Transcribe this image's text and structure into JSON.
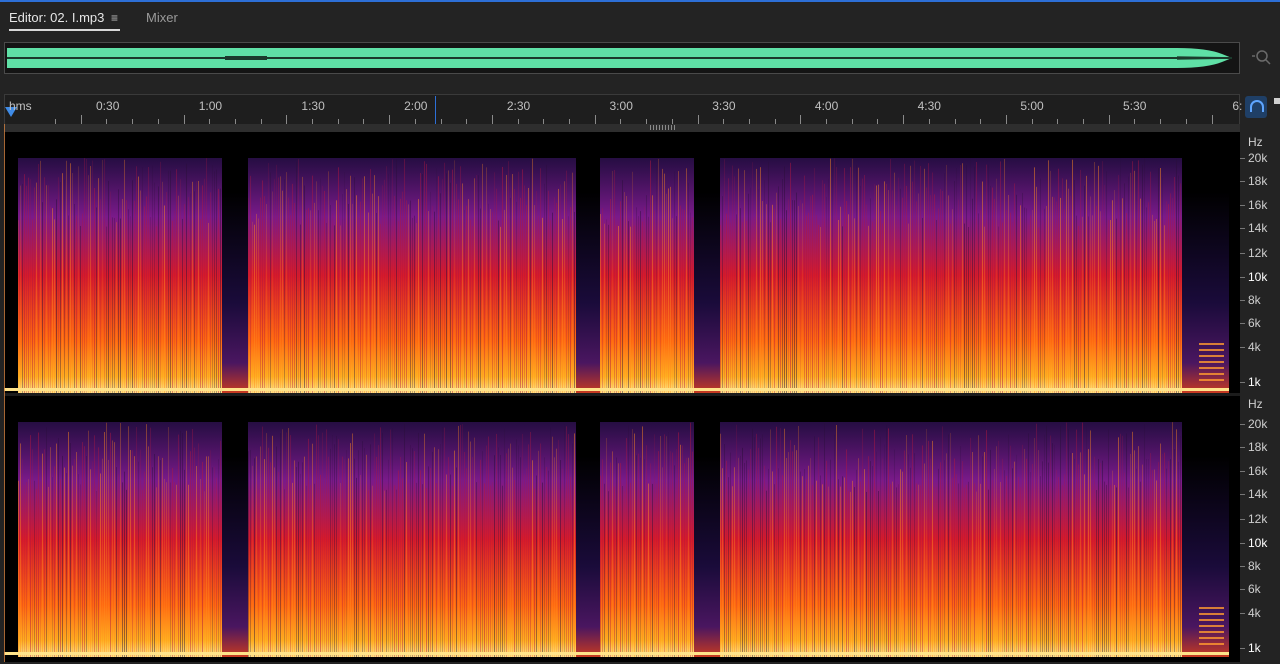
{
  "tabs": {
    "editor_label": "Editor: 02. I.mp3",
    "menu_icon": "≡",
    "mixer_label": "Mixer"
  },
  "overview": {
    "icon": "zoom-navigator-icon"
  },
  "ruler": {
    "labels": [
      "hms",
      "0:30",
      "1:00",
      "1:30",
      "2:00",
      "2:30",
      "3:00",
      "3:30",
      "4:00",
      "4:30",
      "5:00",
      "5:30",
      "6:"
    ],
    "playhead_time": "0:00"
  },
  "spectrogram": {
    "channels": [
      {
        "unit": "Hz",
        "labels": [
          "20k",
          "18k",
          "16k",
          "14k",
          "12k",
          "10k",
          "8k",
          "6k",
          "4k",
          "1k"
        ]
      },
      {
        "unit": "Hz",
        "labels": [
          "20k",
          "18k",
          "16k",
          "14k",
          "12k",
          "10k",
          "8k",
          "6k",
          "4k",
          "1k"
        ]
      }
    ],
    "colors": {
      "low": "#2a0f4a",
      "mid": "#d61a2a",
      "high": "#ffb020",
      "peak": "#ffe38a"
    }
  },
  "controls": {
    "loop_icon": "loop-playback-icon"
  },
  "colors": {
    "accent": "#2d6fd6",
    "waveform": "#5fe0a6",
    "playhead": "#3f8be6"
  }
}
